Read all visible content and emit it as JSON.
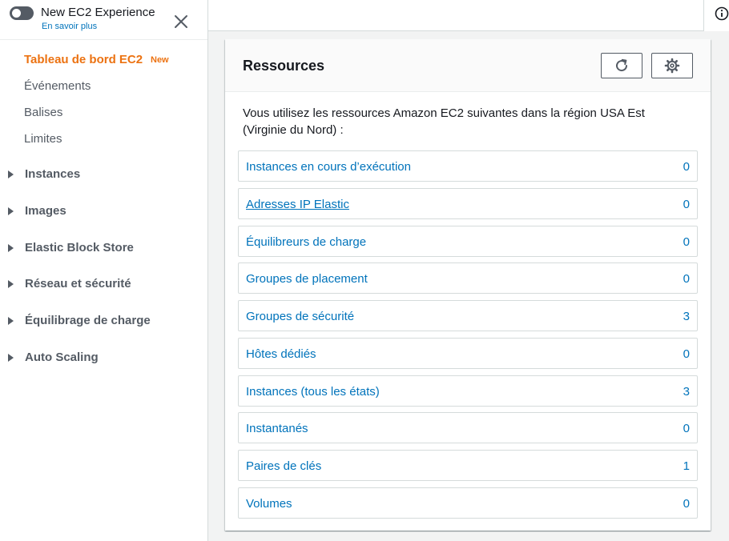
{
  "sidebar": {
    "experience_title": "New EC2 Experience",
    "experience_link": "En savoir plus",
    "links": [
      {
        "label": "Tableau de bord EC2",
        "badge": "New",
        "active": true
      },
      {
        "label": "Événements"
      },
      {
        "label": "Balises"
      },
      {
        "label": "Limites"
      }
    ],
    "sections": [
      {
        "label": "Instances"
      },
      {
        "label": "Images"
      },
      {
        "label": "Elastic Block Store"
      },
      {
        "label": "Réseau et sécurité"
      },
      {
        "label": "Équilibrage de charge"
      },
      {
        "label": "Auto Scaling"
      }
    ]
  },
  "panel": {
    "title": "Ressources",
    "description": "Vous utilisez les ressources Amazon EC2 suivantes dans la région USA Est (Virginie du Nord) :",
    "resources": [
      {
        "name": "Instances en cours d’exécution",
        "count": "0"
      },
      {
        "name": "Adresses IP Elastic",
        "count": "0"
      },
      {
        "name": "Équilibreurs de charge",
        "count": "0"
      },
      {
        "name": "Groupes de placement",
        "count": "0"
      },
      {
        "name": "Groupes de sécurité",
        "count": "3"
      },
      {
        "name": "Hôtes dédiés",
        "count": "0"
      },
      {
        "name": "Instances (tous les états)",
        "count": "3"
      },
      {
        "name": "Instantanés",
        "count": "0"
      },
      {
        "name": "Paires de clés",
        "count": "1"
      },
      {
        "name": "Volumes",
        "count": "0"
      }
    ]
  },
  "colors": {
    "accent": "#ec7211",
    "link": "#0073bb",
    "text": "#16191f",
    "muted": "#545b64"
  },
  "icons": {
    "toggle": "toggle-switch-icon",
    "close": "close-icon",
    "info": "info-icon",
    "refresh": "refresh-icon",
    "settings": "gear-icon",
    "caret": "caret-right-icon"
  }
}
